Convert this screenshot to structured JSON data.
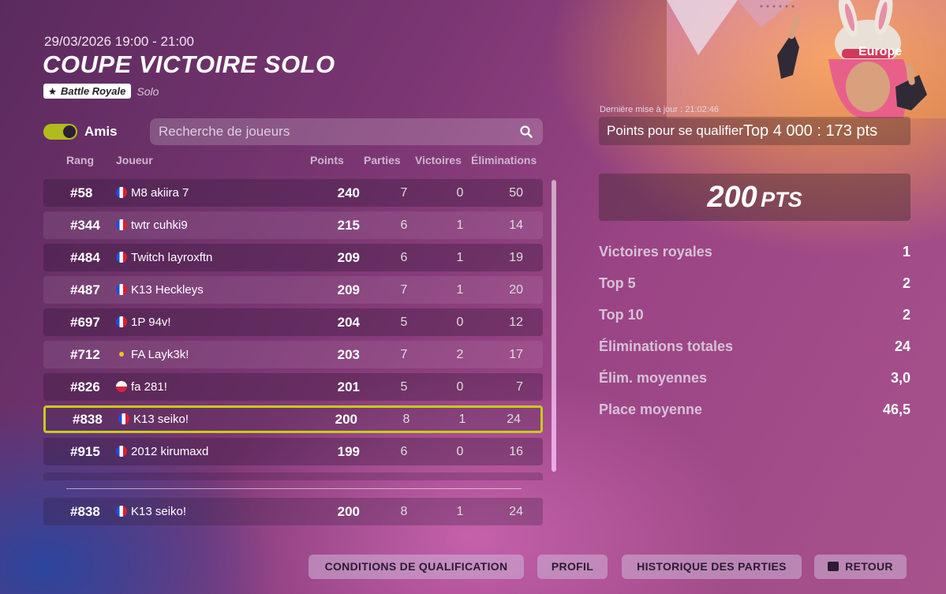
{
  "header": {
    "datetime": "29/03/2026 19:00 - 21:00",
    "title": "COUPE VICTOIRE SOLO",
    "mode_badge": "Battle Royale",
    "mode_sub": "Solo"
  },
  "filters": {
    "friends_label": "Amis",
    "friends_on": true,
    "search_placeholder": "Recherche de joueurs"
  },
  "columns": {
    "rank": "Rang",
    "player": "Joueur",
    "points": "Points",
    "games": "Parties",
    "wins": "Victoires",
    "elims": "Éliminations"
  },
  "rows": [
    {
      "rank": "#58",
      "flag": "fr",
      "name": "M8 akiira 7",
      "points": "240",
      "games": "7",
      "wins": "0",
      "elims": "50"
    },
    {
      "rank": "#344",
      "flag": "fr",
      "name": "twtr cuhki9",
      "points": "215",
      "games": "6",
      "wins": "1",
      "elims": "14"
    },
    {
      "rank": "#484",
      "flag": "fr",
      "name": "Twitch layroxftn",
      "points": "209",
      "games": "6",
      "wins": "1",
      "elims": "19"
    },
    {
      "rank": "#487",
      "flag": "fr",
      "name": "K13 Heckleys",
      "points": "209",
      "games": "7",
      "wins": "1",
      "elims": "20"
    },
    {
      "rank": "#697",
      "flag": "fr",
      "name": "1P 94v!",
      "points": "204",
      "games": "5",
      "wins": "0",
      "elims": "12"
    },
    {
      "rank": "#712",
      "flag": "pt",
      "name": "FA Layk3k!",
      "points": "203",
      "games": "7",
      "wins": "2",
      "elims": "17"
    },
    {
      "rank": "#826",
      "flag": "pl",
      "name": "fa 281!",
      "points": "201",
      "games": "5",
      "wins": "0",
      "elims": "7"
    },
    {
      "rank": "#838",
      "flag": "fr",
      "name": "K13 seiko!",
      "points": "200",
      "games": "8",
      "wins": "1",
      "elims": "24",
      "highlight": true
    },
    {
      "rank": "#915",
      "flag": "fr",
      "name": "2012 kirumaxd",
      "points": "199",
      "games": "6",
      "wins": "0",
      "elims": "16"
    }
  ],
  "self_row": {
    "rank": "#838",
    "flag": "fr",
    "name": "K13 seiko!",
    "points": "200",
    "games": "8",
    "wins": "1",
    "elims": "24"
  },
  "panel": {
    "region": "Europe",
    "last_update": "Dernière mise à jour : 21:02:46",
    "qualify_label": "Points pour se qualifier",
    "qualify_value": "Top 4 000 : 173 pts",
    "score_num": "200",
    "score_unit": "PTS",
    "stats": [
      {
        "label": "Victoires royales",
        "value": "1"
      },
      {
        "label": "Top 5",
        "value": "2"
      },
      {
        "label": "Top 10",
        "value": "2"
      },
      {
        "label": "Éliminations totales",
        "value": "24"
      },
      {
        "label": "Élim. moyennes",
        "value": "3,0"
      },
      {
        "label": "Place moyenne",
        "value": "46,5"
      }
    ]
  },
  "buttons": {
    "conditions": "CONDITIONS DE QUALIFICATION",
    "profile": "PROFIL",
    "history": "HISTORIQUE DES PARTIES",
    "back": "RETOUR"
  },
  "colors": {
    "accent_toggle": "#b2bb1e",
    "highlight_border": "#c6cc1c"
  }
}
